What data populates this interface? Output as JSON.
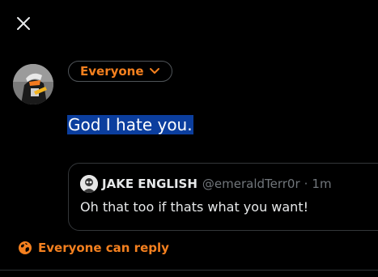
{
  "compose": {
    "audience_label": "Everyone",
    "tweet_text": "God I hate you."
  },
  "quoted_tweet": {
    "display_name": "JAKE ENGLISH",
    "handle": "@emeraldTerr0r",
    "separator": "·",
    "time": "1m",
    "body": "Oh that too if thats what you want!"
  },
  "reply_setting": {
    "label": "Everyone can reply"
  },
  "colors": {
    "accent": "#f4801f",
    "background": "#000000",
    "selection": "#0b3e9e",
    "text": "#e7e9ea",
    "muted": "#71767b",
    "border": "#333639"
  },
  "icons": {
    "close": "close-icon",
    "audience_chevron": "chevron-down-icon",
    "reply_globe": "globe-icon"
  }
}
